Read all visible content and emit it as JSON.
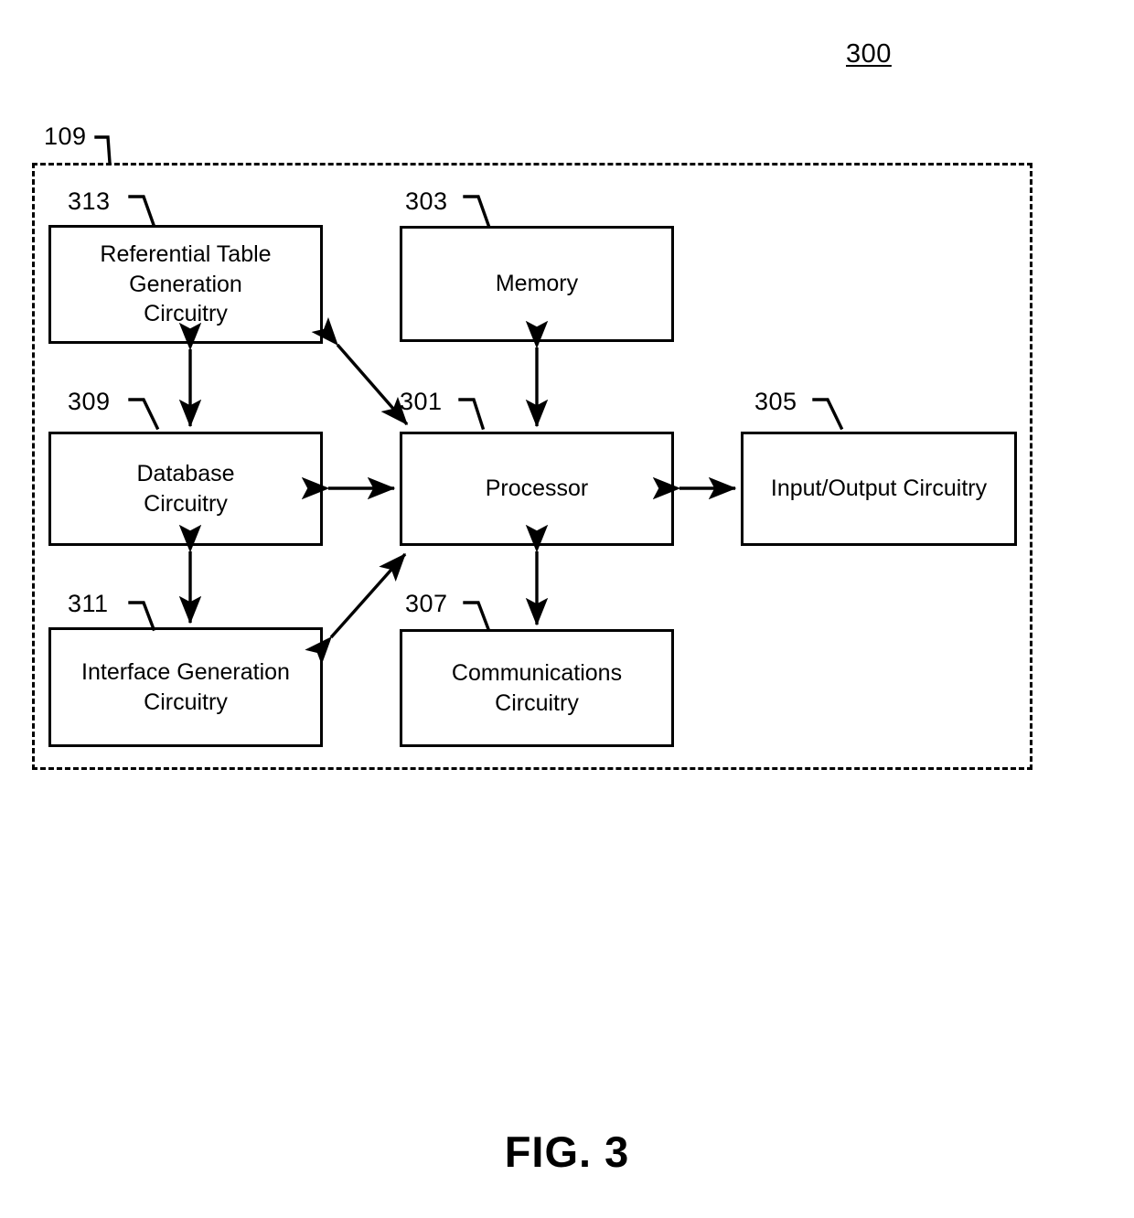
{
  "figure": {
    "caption": "FIG. 3",
    "diagram_ref": "300",
    "enclosure_ref": "109"
  },
  "nodes": [
    {
      "ref": "313",
      "label": "Referential Table Generation Circuitry",
      "lines": [
        "Referential Table",
        "Generation",
        "Circuitry"
      ]
    },
    {
      "ref": "303",
      "label": "Memory",
      "lines": [
        "Memory"
      ]
    },
    {
      "ref": "309",
      "label": "Database Circuitry",
      "lines": [
        "Database",
        "Circuitry"
      ]
    },
    {
      "ref": "301",
      "label": "Processor",
      "lines": [
        "Processor"
      ]
    },
    {
      "ref": "305",
      "label": "Input/Output Circuitry",
      "lines": [
        "Input/Output Circuitry"
      ]
    },
    {
      "ref": "311",
      "label": "Interface Generation Circuitry",
      "lines": [
        "Interface Generation",
        "Circuitry"
      ]
    },
    {
      "ref": "307",
      "label": "Communications Circuitry",
      "lines": [
        "Communications",
        "Circuitry"
      ]
    }
  ],
  "connections": [
    {
      "from": "313",
      "to": "309",
      "style": "double-arrow-vertical"
    },
    {
      "from": "313",
      "to": "301",
      "style": "double-arrow-diagonal"
    },
    {
      "from": "303",
      "to": "301",
      "style": "double-arrow-vertical"
    },
    {
      "from": "309",
      "to": "301",
      "style": "double-arrow-horizontal"
    },
    {
      "from": "301",
      "to": "305",
      "style": "double-arrow-horizontal"
    },
    {
      "from": "309",
      "to": "311",
      "style": "double-arrow-vertical"
    },
    {
      "from": "311",
      "to": "301",
      "style": "double-arrow-diagonal"
    },
    {
      "from": "301",
      "to": "307",
      "style": "double-arrow-vertical"
    }
  ],
  "colors": {
    "ink": "#000000",
    "paper": "#ffffff"
  }
}
